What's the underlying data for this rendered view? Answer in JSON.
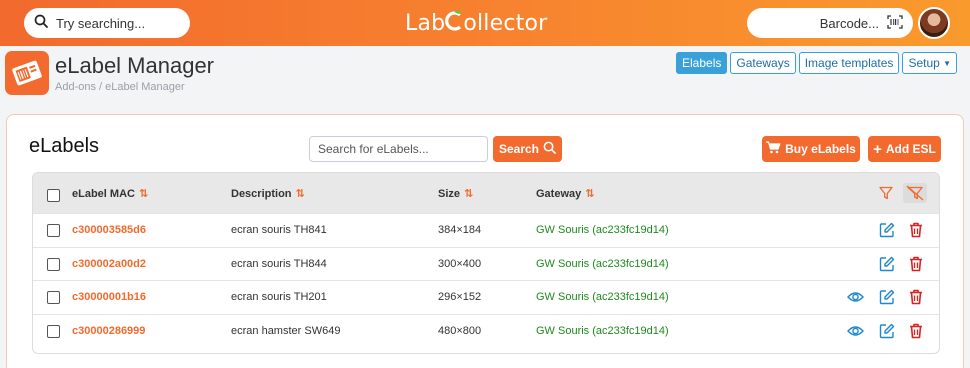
{
  "topbar": {
    "search_placeholder": "Try searching...",
    "logo_prefix": "Lab",
    "logo_suffix": "ollector",
    "barcode_label": "Barcode..."
  },
  "header": {
    "title": "eLabel Manager",
    "breadcrumb": "Add-ons / eLabel Manager",
    "nav": [
      "Elabels",
      "Gateways",
      "Image templates",
      "Setup"
    ]
  },
  "card": {
    "title": "eLabels",
    "search_placeholder": "Search for eLabels...",
    "search_button": "Search",
    "buy_button": "Buy eLabels",
    "add_button": "Add ESL"
  },
  "table": {
    "columns": [
      "eLabel MAC",
      "Description",
      "Size",
      "Gateway"
    ],
    "rows": [
      {
        "mac": "c300003585d6",
        "description": "ecran souris TH841",
        "size": "384×184",
        "gateway": "GW Souris (ac233fc19d14)",
        "has_view": false
      },
      {
        "mac": "c300002a00d2",
        "description": "ecran souris TH844",
        "size": "300×400",
        "gateway": "GW Souris (ac233fc19d14)",
        "has_view": false
      },
      {
        "mac": "c30000001b16",
        "description": "ecran souris TH201",
        "size": "296×152",
        "gateway": "GW Souris (ac233fc19d14)",
        "has_view": true
      },
      {
        "mac": "c30000286999",
        "description": "ecran hamster SW649",
        "size": "480×800",
        "gateway": "GW Souris (ac233fc19d14)",
        "has_view": true
      }
    ]
  },
  "colors": {
    "accent": "#f26a2e",
    "nav_blue": "#3aa0d8",
    "gateway_green": "#1e8a1e",
    "delete_red": "#e02020",
    "edit_blue": "#1e88c8"
  },
  "icons": [
    "search-icon",
    "barcode-scan-icon",
    "cart-icon",
    "plus-icon",
    "sort-icon",
    "filter-icon",
    "clear-filter-icon",
    "eye-icon",
    "edit-icon",
    "trash-icon"
  ]
}
